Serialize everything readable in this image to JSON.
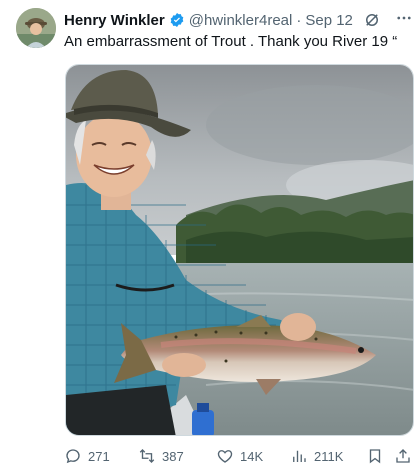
{
  "tweet": {
    "author_name": "Henry Winkler",
    "handle": "@hwinkler4real",
    "separator": "·",
    "date": "Sep 12",
    "text": "An embarrassment of Trout . Thank you River 19 “"
  },
  "actions": {
    "replies": "271",
    "reposts": "387",
    "likes": "14K",
    "views": "211K"
  },
  "colors": {
    "verified": "#1d9bf0",
    "secondary_text": "#536471",
    "primary_text": "#0f1419"
  },
  "icons": [
    "verified-badge-icon",
    "grok-icon",
    "more-icon",
    "reply-icon",
    "repost-icon",
    "like-icon",
    "views-icon",
    "bookmark-icon",
    "share-icon"
  ]
}
